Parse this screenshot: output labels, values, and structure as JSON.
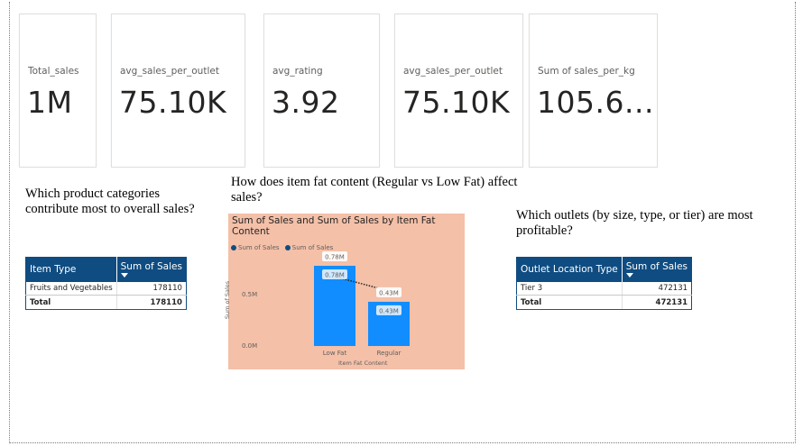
{
  "kpi_cards": [
    {
      "label": "Total_sales",
      "value": "1M"
    },
    {
      "label": "avg_sales_per_outlet",
      "value": "75.10K"
    },
    {
      "label": "avg_rating",
      "value": "3.92"
    },
    {
      "label": "avg_sales_per_outlet",
      "value": "75.10K"
    },
    {
      "label": "Sum of sales_per_kg",
      "value": "105.6..."
    }
  ],
  "questions": {
    "q1": "Which product categories contribute most to overall sales?",
    "q2": "How does item fat content (Regular vs Low Fat) affect sales?",
    "q3": "Which outlets (by size, type, or tier) are most profitable?"
  },
  "table_item_type": {
    "headers": [
      "Item Type",
      "Sum of Sales"
    ],
    "rows": [
      [
        "Fruits and Vegetables",
        "178110"
      ]
    ],
    "total": [
      "Total",
      "178110"
    ]
  },
  "table_outlet": {
    "headers": [
      "Outlet Location Type",
      "Sum of Sales"
    ],
    "rows": [
      [
        "Tier 3",
        "472131"
      ]
    ],
    "total": [
      "Total",
      "472131"
    ]
  },
  "chart_data": {
    "type": "bar",
    "title": "Sum of Sales and Sum of Sales by Item Fat Content",
    "legend": [
      "Sum of Sales",
      "Sum of Sales"
    ],
    "categories": [
      "Low Fat",
      "Regular"
    ],
    "series": [
      {
        "name": "Sum of Sales",
        "values": [
          0.78,
          0.43
        ]
      },
      {
        "name": "Sum of Sales",
        "values": [
          0.78,
          0.43
        ]
      }
    ],
    "data_labels": [
      "0.78M",
      "0.43M"
    ],
    "xlabel": "Item Fat Content",
    "ylabel": "Sum of Sales",
    "yticks": [
      "0.0M",
      "0.5M"
    ],
    "ylim": [
      0,
      0.85
    ],
    "background_color": "#f4c0a8",
    "bar_color": "#118dff"
  },
  "colors": {
    "table_header": "#0f4c81",
    "legend_dot": "#0f4c81"
  }
}
